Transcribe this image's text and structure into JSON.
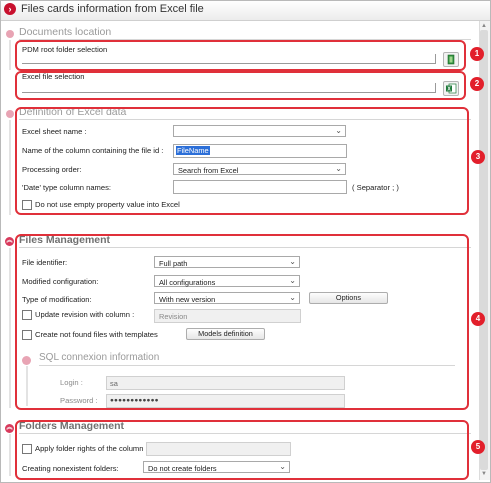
{
  "window": {
    "title": "Files cards information from Excel file"
  },
  "sections": {
    "documents": {
      "header": "Documents location",
      "pdm_label": "PDM root folder selection",
      "pdm_value": "",
      "excel_label": "Excel file selection",
      "excel_value": ""
    },
    "excel_def": {
      "header": "Definition of Excel data",
      "sheet_label": "Excel sheet name :",
      "sheet_value": "",
      "column_label": "Name of the column containing the file id :",
      "column_value": "FileName",
      "order_label": "Processing order:",
      "order_value": "Search from Excel",
      "date_label": "'Date' type column names:",
      "date_value": "",
      "separator_label": "( Separator ; )",
      "empty_prop_label": "Do not use empty property value into Excel"
    },
    "files": {
      "header": "Files Management",
      "identifier_label": "File identifier:",
      "identifier_value": "Full path",
      "modconf_label": "Modified configuration:",
      "modconf_value": "All configurations",
      "modtype_label": "Type of modification:",
      "modtype_value": "With new version",
      "options_button": "Options",
      "update_rev_label": "Update revision with column :",
      "update_rev_value": "Revision",
      "create_files_label": "Create not found files with templates",
      "models_button": "Models definition",
      "sql_header": "SQL connexion information",
      "login_label": "Login :",
      "login_value": "sa",
      "password_label": "Password :",
      "password_value": "●●●●●●●●●●●●"
    },
    "folders": {
      "header": "Folders Management",
      "apply_rights_label": "Apply folder rights of the column :",
      "apply_rights_value": "",
      "create_folders_label": "Creating nonexistent folders:",
      "create_folders_value": "Do not create folders"
    }
  },
  "badges": [
    "1",
    "2",
    "3",
    "4",
    "5"
  ],
  "icons": {
    "title": "chevron-right-icon",
    "folder_browse": "green-folder-icon",
    "excel_browse": "excel-file-icon",
    "collapse": "double-chevron-up-icon"
  },
  "colors": {
    "accent_red": "#e0303a",
    "header_gray": "#9a9a9a",
    "excel_green": "#1f7a3b"
  }
}
